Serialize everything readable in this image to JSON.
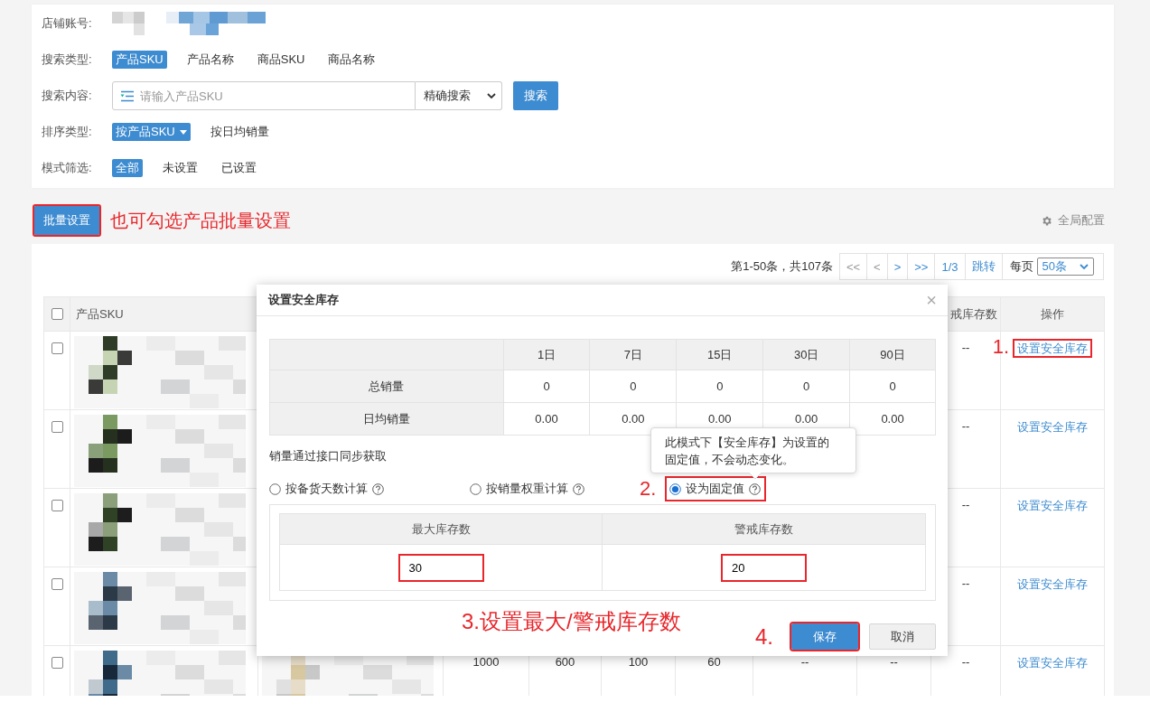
{
  "filters": {
    "shop_account": {
      "label": "店铺账号:",
      "value": {
        "kind": "picture"
      }
    },
    "search_type": {
      "label": "搜索类型:",
      "options": [
        {
          "label": "产品SKU",
          "selected": true
        },
        {
          "label": "产品名称",
          "selected": false
        },
        {
          "label": "商品SKU",
          "selected": false
        },
        {
          "label": "商品名称",
          "selected": false
        }
      ]
    },
    "search_content": {
      "label": "搜索内容:",
      "placeholder": "请输入产品SKU",
      "mode": "精确搜索",
      "button": "搜索"
    },
    "sort_type": {
      "label": "排序类型:",
      "options": [
        {
          "label": "按产品SKU",
          "selected": true,
          "dropdown": true
        },
        {
          "label": "按日均销量",
          "selected": false,
          "dropdown": false
        }
      ]
    },
    "mode_filter": {
      "label": "模式筛选:",
      "options": [
        {
          "label": "全部",
          "selected": true
        },
        {
          "label": "未设置",
          "selected": false
        },
        {
          "label": "已设置",
          "selected": false
        }
      ]
    }
  },
  "toolbar": {
    "batch_button": {
      "label": "批量设置",
      "highlighted": true
    },
    "hint": "也可勾选产品批量设置",
    "global_config": "全局配置"
  },
  "pagination": {
    "summary": "第1-50条，共107条",
    "buttons": [
      {
        "label": "<<",
        "disabled": true
      },
      {
        "label": "<",
        "disabled": true
      },
      {
        "label": ">",
        "disabled": false
      },
      {
        "label": ">>",
        "disabled": false
      },
      {
        "label": "1/3",
        "disabled": false
      },
      {
        "label": "跳转",
        "disabled": false
      }
    ],
    "per_page_label": "每页",
    "per_page": "50条"
  },
  "table": {
    "header_checked": false,
    "columns": [
      "产品SKU",
      null,
      null,
      null,
      null,
      null,
      null,
      null,
      "戒库存数",
      "操作"
    ],
    "rows": [
      {
        "checked": false,
        "cells": [
          {
            "kind": "picture"
          },
          null,
          null,
          null,
          null,
          null,
          null,
          null,
          "--",
          {
            "kind": "link",
            "label": "设置安全库存",
            "highlighted": true,
            "step": "1."
          }
        ]
      },
      {
        "checked": false,
        "cells": [
          {
            "kind": "picture"
          },
          null,
          null,
          null,
          null,
          null,
          null,
          null,
          "--",
          {
            "kind": "link",
            "label": "设置安全库存",
            "highlighted": false
          }
        ]
      },
      {
        "checked": false,
        "cells": [
          {
            "kind": "picture"
          },
          null,
          null,
          null,
          null,
          null,
          null,
          null,
          "--",
          {
            "kind": "link",
            "label": "设置安全库存",
            "highlighted": false
          }
        ]
      },
      {
        "checked": false,
        "cells": [
          {
            "kind": "picture"
          },
          null,
          null,
          null,
          null,
          null,
          null,
          null,
          "--",
          {
            "kind": "link",
            "label": "设置安全库存",
            "highlighted": false
          }
        ]
      },
      {
        "checked": false,
        "cells": [
          {
            "kind": "picture"
          },
          {
            "kind": "picture"
          },
          "1000",
          "600",
          "100",
          "60",
          "--",
          "--",
          "--",
          {
            "kind": "link",
            "label": "设置安全库存",
            "highlighted": false
          }
        ]
      }
    ]
  },
  "dialog": {
    "title": "设置安全库存",
    "close": "×",
    "sales_table": {
      "columns": [
        "1日",
        "7日",
        "15日",
        "30日",
        "90日"
      ],
      "rows": [
        {
          "label": "总销量",
          "values": [
            "0",
            "0",
            "0",
            "0",
            "0"
          ]
        },
        {
          "label": "日均销量",
          "values": [
            "0.00",
            "0.00",
            "0.00",
            "0.00",
            "0.00"
          ]
        }
      ]
    },
    "source_note": "销量通过接口同步获取",
    "modes": [
      {
        "label": "按备货天数计算",
        "selected": false,
        "highlighted": false
      },
      {
        "label": "按销量权重计算",
        "selected": false,
        "highlighted": false
      },
      {
        "label": "设为固定值",
        "selected": true,
        "highlighted": true,
        "step": "2.",
        "tooltip": "此模式下【安全库存】为设置的固定值，不会动态变化。"
      }
    ],
    "fixed_table": {
      "columns": [
        "最大库存数",
        "警戒库存数"
      ],
      "fields": [
        {
          "value": "30",
          "highlighted": true
        },
        {
          "value": "20",
          "highlighted": true
        }
      ]
    },
    "step_note": "3.设置最大/警戒库存数",
    "buttons": [
      {
        "label": "保存",
        "kind": "primary",
        "highlighted": true,
        "step": "4."
      },
      {
        "label": "取消",
        "kind": "default",
        "highlighted": false
      }
    ]
  }
}
